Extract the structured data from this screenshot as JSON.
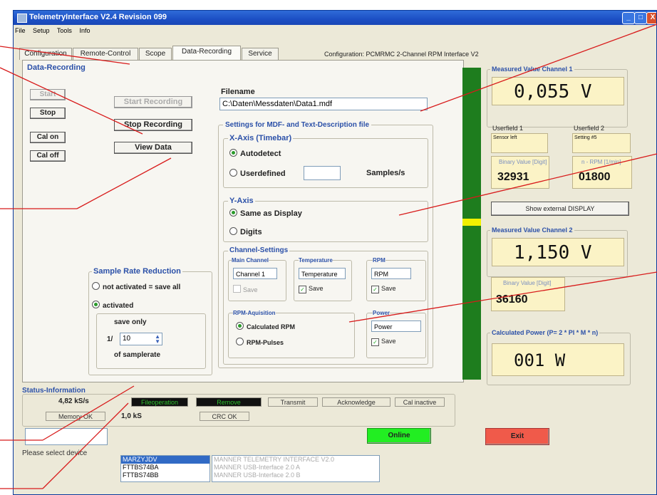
{
  "window": {
    "title": "TelemetryInterface V2.4 Revision 099",
    "min": "_",
    "max": "□",
    "close": "X"
  },
  "menu": [
    "File",
    "Setup",
    "Tools",
    "Info"
  ],
  "tabs": [
    "Configuration",
    "Remote-Control",
    "Scope",
    "Data-Recording",
    "Service"
  ],
  "configuration_text": "Configuration: PCMRMC 2-Channel RPM Interface V2",
  "data_recording": {
    "title": "Data-Recording",
    "start": "Start",
    "stop": "Stop",
    "cal_on": "Cal on",
    "cal_off": "Cal off",
    "start_recording": "Start Recording",
    "stop_recording": "Stop Recording",
    "view_data": "View Data",
    "filename_label": "Filename",
    "filename_value": "C:\\Daten\\Messdaten\\Data1.mdf"
  },
  "mdf": {
    "title": "Settings for MDF- and Text-Description file",
    "xaxis": {
      "title": "X-Axis (Timebar)",
      "autodetect": "Autodetect",
      "userdefined": "Userdefined",
      "unit": "Samples/s",
      "value": ""
    },
    "yaxis": {
      "title": "Y-Axis",
      "same": "Same as Display",
      "digits": "Digits"
    },
    "channel": {
      "title": "Channel-Settings",
      "main_label": "Main Channel",
      "main_value": "Channel 1",
      "main_save": "Save",
      "temp_label": "Temperature",
      "temp_value": "Temperature",
      "temp_save": "Save",
      "rpm_label": "RPM",
      "rpm_value": "RPM",
      "rpm_save": "Save",
      "aq_title": "RPM-Aquisition",
      "calc": "Calculated RPM",
      "pulses": "RPM-Pulses",
      "power_label": "Power",
      "power_value": "Power",
      "power_save": "Save"
    }
  },
  "sample_rate": {
    "title": "Sample Rate Reduction",
    "not_activated": "not activated = save all",
    "activated": "activated",
    "save_only": "save only",
    "prefix": "1/",
    "value": "10",
    "suffix": "of samplerate"
  },
  "status": {
    "title": "Status-Information",
    "rate": "4,82 kS/s",
    "file_op": "Fileoperation",
    "remove": "Remove",
    "transmit": "Transmit",
    "ack": "Acknowledge",
    "cal_inactive": "Cal inactive",
    "memory": "Memory OK",
    "ks": "1,0 kS",
    "crc": "CRC OK",
    "online": "Online"
  },
  "device": {
    "label": "Please select device",
    "ids": [
      "MARZYJDV",
      "FTTBS74BA",
      "FTTBS74BB"
    ],
    "descs": [
      "MANNER TELEMETRY INTERFACE V2.0",
      "MANNER USB-Interface 2.0 A",
      "MANNER USB-Interface 2.0 B"
    ]
  },
  "right": {
    "ch1_title": "Measured Value Channel 1",
    "ch1_value": "0,055 V",
    "userfield1": "Userfield 1",
    "userfield1_value": "Sensor left",
    "userfield2": "Userfield 2",
    "userfield2_value": "Setting #5",
    "binary_label": "Binary Value [Digit]",
    "binary_value": "32931",
    "rpm_label": "n - RPM [1/min]",
    "rpm_value": "01800",
    "show_display": "Show external DISPLAY",
    "ch2_title": "Measured Value Channel 2",
    "ch2_value": "1,150 V",
    "binary2_label": "Binary Value [Digit]",
    "binary2_value": "36160",
    "power_title": "Calculated Power (P= 2 * PI * M * n)",
    "power_value": "001 W",
    "exit": "Exit"
  },
  "colors": {
    "bar": "#1e7d1e",
    "marker": "#f2f000",
    "online": "#22ee22",
    "exit": "#f05a4a",
    "annotation": "#d81b1b"
  }
}
